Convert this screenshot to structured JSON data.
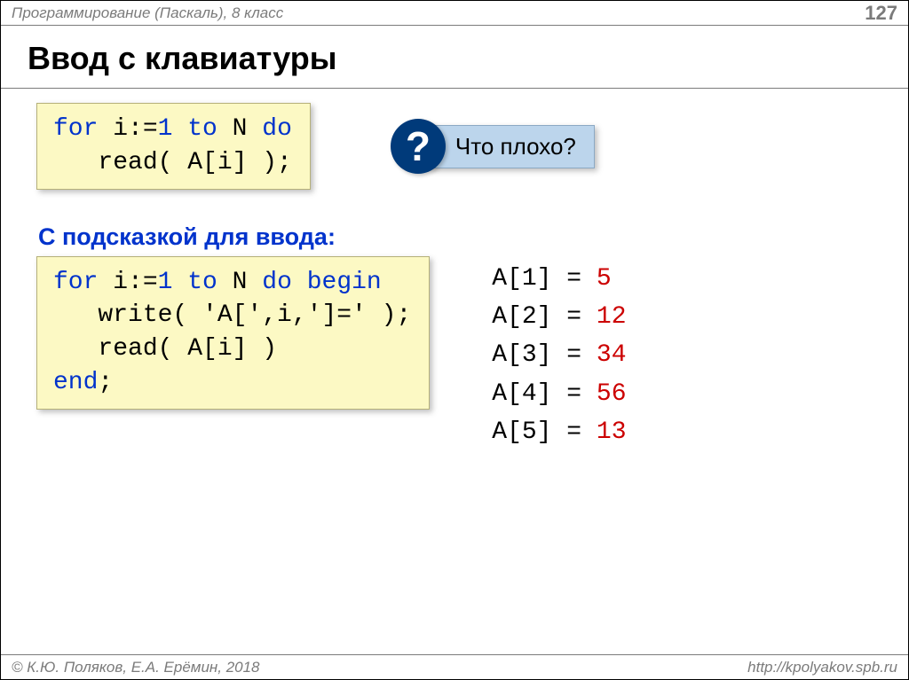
{
  "header": {
    "course": "Программирование (Паскаль), 8 класс",
    "page": "127"
  },
  "title": "Ввод с клавиатуры",
  "code1": {
    "line1_a": "for",
    "line1_b": " i:=",
    "line1_c": "1",
    "line1_d": " to",
    "line1_e": " N ",
    "line1_f": "do",
    "line2_a": "   read( A[i] );"
  },
  "hint": {
    "mark": "?",
    "text": "Что плохо?"
  },
  "subheader": "С подсказкой для ввода:",
  "code2": {
    "l1a": "for",
    "l1b": " i:=",
    "l1c": "1",
    "l1d": " to",
    "l1e": " N ",
    "l1f": "do",
    "l1g": " begin",
    "l2": "   write( 'A[',i,']=' );",
    "l3": "   read( A[i] )",
    "l4a": "end",
    "l4b": ";"
  },
  "output": [
    {
      "label": "A[1] =",
      "value": "5"
    },
    {
      "label": "A[2] =",
      "value": "12"
    },
    {
      "label": "A[3] =",
      "value": "34"
    },
    {
      "label": "A[4] =",
      "value": "56"
    },
    {
      "label": "A[5] =",
      "value": "13"
    }
  ],
  "footer": {
    "authors": "© К.Ю. Поляков, Е.А. Ерёмин, 2018",
    "url": "http://kpolyakov.spb.ru"
  }
}
